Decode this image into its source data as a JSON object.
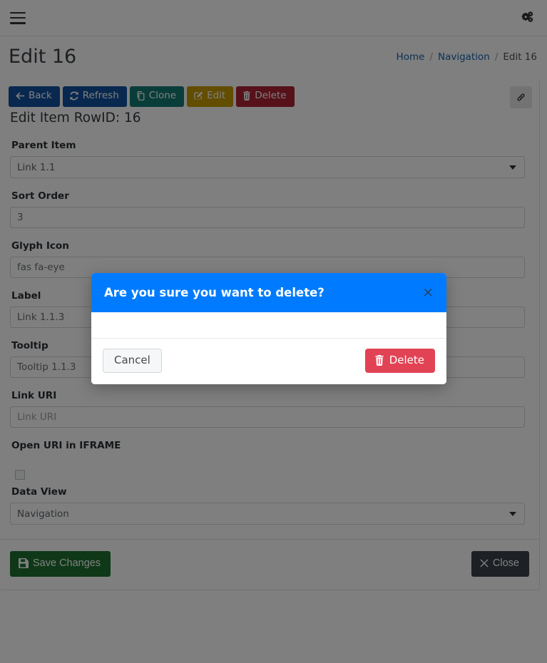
{
  "navbar": {
    "menu_icon": "hamburger-icon",
    "settings_icon": "cogs-icon"
  },
  "header": {
    "title": "Edit 16",
    "breadcrumb": {
      "items": [
        {
          "label": "Home",
          "link": true
        },
        {
          "label": "Navigation",
          "link": true
        },
        {
          "label": "Edit 16",
          "link": false
        }
      ],
      "separator": "/"
    }
  },
  "toolbar": {
    "back_label": "Back",
    "refresh_label": "Refresh",
    "clone_label": "Clone",
    "edit_label": "Edit",
    "delete_label": "Delete",
    "link_icon": "link-icon",
    "colors": {
      "back": "#11519e",
      "refresh": "#11519e",
      "clone": "#137b74",
      "edit": "#c49a00",
      "delete": "#ac2232"
    }
  },
  "card": {
    "subtitle": "Edit Item RowID: 16"
  },
  "form": {
    "fields": [
      {
        "name": "parent-item",
        "label": "Parent Item",
        "type": "select",
        "value": "Link 1.1"
      },
      {
        "name": "sort-order",
        "label": "Sort Order",
        "type": "text",
        "value": "3",
        "placeholder": "Sort Order"
      },
      {
        "name": "glyph-icon",
        "label": "Glyph Icon",
        "type": "text",
        "value": "fas fa-eye",
        "placeholder": "Glyph Icon"
      },
      {
        "name": "label",
        "label": "Label",
        "type": "text",
        "value": "Link 1.1.3",
        "placeholder": "Label"
      },
      {
        "name": "tooltip",
        "label": "Tooltip",
        "type": "text",
        "value": "Tooltip 1.1.3",
        "placeholder": "Tooltip"
      },
      {
        "name": "link-uri",
        "label": "Link URI",
        "type": "text",
        "value": "",
        "placeholder": "Link URI"
      },
      {
        "name": "open-uri-in-iframe",
        "label": "Open URI in IFRAME",
        "type": "checkbox",
        "checked": false
      },
      {
        "name": "data-view",
        "label": "Data View",
        "type": "select",
        "value": "Navigation"
      }
    ]
  },
  "footer": {
    "save_label": "Save Changes",
    "save_icon": "floppy-disk-icon",
    "close_label": "Close",
    "close_icon": "times-icon"
  },
  "modal": {
    "title": "Are you sure you want to delete?",
    "close_icon": "close-x-icon",
    "close_glyph": "×",
    "body_text": "",
    "cancel_label": "Cancel",
    "delete_label": "Delete",
    "delete_icon": "trash-icon",
    "header_color": "#007bff",
    "delete_color": "#e24354"
  }
}
